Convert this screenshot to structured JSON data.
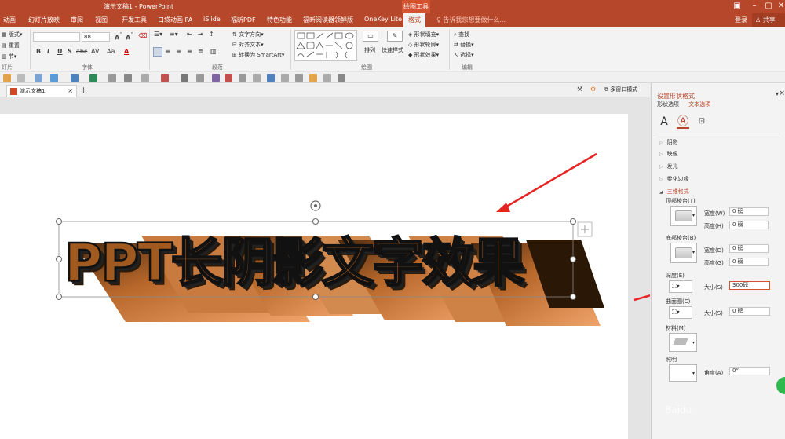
{
  "title_bar": {
    "title": "演示文稿1 - PowerPoint",
    "context_group": "绘图工具",
    "window_controls": [
      "restore-ribbon-icon",
      "minimize-icon",
      "maximize-icon",
      "close-icon"
    ]
  },
  "menu_tabs": [
    {
      "label": "动画"
    },
    {
      "label": "幻灯片放映"
    },
    {
      "label": "审阅"
    },
    {
      "label": "视图"
    },
    {
      "label": "开发工具"
    },
    {
      "label": "口袋动画 PA"
    },
    {
      "label": "iSlide"
    },
    {
      "label": "福昕PDF"
    },
    {
      "label": "特色功能"
    },
    {
      "label": "福昕阅读器领鲜版"
    },
    {
      "label": "OneKey Lite"
    },
    {
      "label": "格式",
      "active": true
    }
  ],
  "tell_me": "告诉我您想要做什么...",
  "login": "登录",
  "share": "共享",
  "ribbon": {
    "slides_group": {
      "layout": "版式",
      "reset": "重置",
      "section": "节",
      "label": "灯片"
    },
    "font_group": {
      "font_name": "",
      "font_size": "88",
      "label": "字体",
      "buttons": [
        "B",
        "I",
        "U",
        "S",
        "abc",
        "AV",
        "Aa",
        "A"
      ]
    },
    "paragraph_group": {
      "text_direction": "文字方向",
      "align_text": "对齐文本",
      "smartart": "转换为 SmartArt",
      "label": "段落"
    },
    "drawing_group": {
      "arrange": "排列",
      "quick_styles": "快速样式",
      "fill": "形状填充",
      "outline": "形状轮廓",
      "effects": "形状效果",
      "label": "绘图"
    },
    "editing_group": {
      "find": "查找",
      "replace": "替换",
      "select": "选择",
      "label": "编辑"
    }
  },
  "doc_tabs": {
    "tab": "演示文稿1",
    "multi_window": "多窗口模式"
  },
  "slide": {
    "headline": "PPT长阴影文字效果"
  },
  "panel": {
    "title": "设置形状格式",
    "tab_shape": "形状选项",
    "tab_text": "文本选项",
    "sections": [
      "阴影",
      "映像",
      "发光",
      "柔化边缘"
    ],
    "open_section": "三维格式",
    "top_bevel": "顶部棱台(T)",
    "bottom_bevel": "底部棱台(B)",
    "width_w": "宽度(W)",
    "height_h": "高度(H)",
    "width_d": "宽度(D)",
    "height_g": "高度(G)",
    "width_w_value": "0 磅",
    "height_h_value": "0 磅",
    "width_d_value": "0 磅",
    "height_g_value": "0 磅",
    "depth": "深度(E)",
    "depth_size_label": "大小(S)",
    "depth_size_value": "300磅",
    "contour": "曲面图(C)",
    "contour_size_label": "大小(S)",
    "contour_size_value": "0 磅",
    "material": "材料(M)",
    "lighting": "照明",
    "angle_label": "角度(A)",
    "angle_value": "0°"
  },
  "watermark": "Baidu",
  "colors": {
    "accent": "#b7472a",
    "shadow_orange": "#d9884a",
    "text_black": "#111111"
  }
}
